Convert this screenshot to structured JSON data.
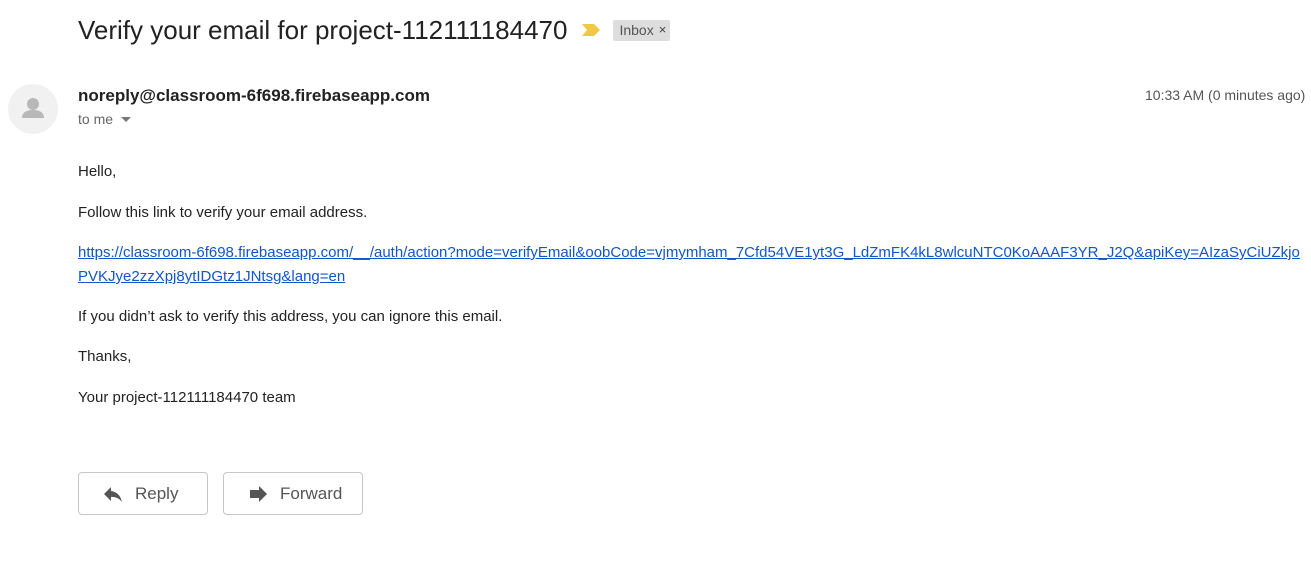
{
  "subject": {
    "text": "Verify your email for project-112111184470",
    "importance_marker": "importance-marker-icon",
    "label": "Inbox",
    "label_remove": "×"
  },
  "message": {
    "sender": "noreply@classroom-6f698.firebaseapp.com",
    "recipient": "to me",
    "timestamp": "10:33 AM (0 minutes ago)",
    "avatar_icon": "person-icon"
  },
  "body": {
    "greeting": "Hello,",
    "instruction": "Follow this link to verify your email address.",
    "link": "https://classroom-6f698.firebaseapp.com/__/auth/action?mode=verifyEmail&oobCode=vjmymham_7Cfd54VE1yt3G_LdZmFK4kL8wlcuNTC0KoAAAF3YR_J2Q&apiKey=AIzaSyCiUZkjoPVKJye2zzXpj8ytIDGtz1JNtsg&lang=en",
    "ignore_note": "If you didn’t ask to verify this address, you can ignore this email.",
    "thanks": "Thanks,",
    "signature": "Your project-112111184470 team"
  },
  "actions": {
    "reply_label": "Reply",
    "forward_label": "Forward",
    "reply_icon": "reply-icon",
    "forward_icon": "forward-icon"
  },
  "colors": {
    "link": "#1155cc",
    "importance_marker": "#f2c744",
    "label_bg": "#dddddd"
  }
}
